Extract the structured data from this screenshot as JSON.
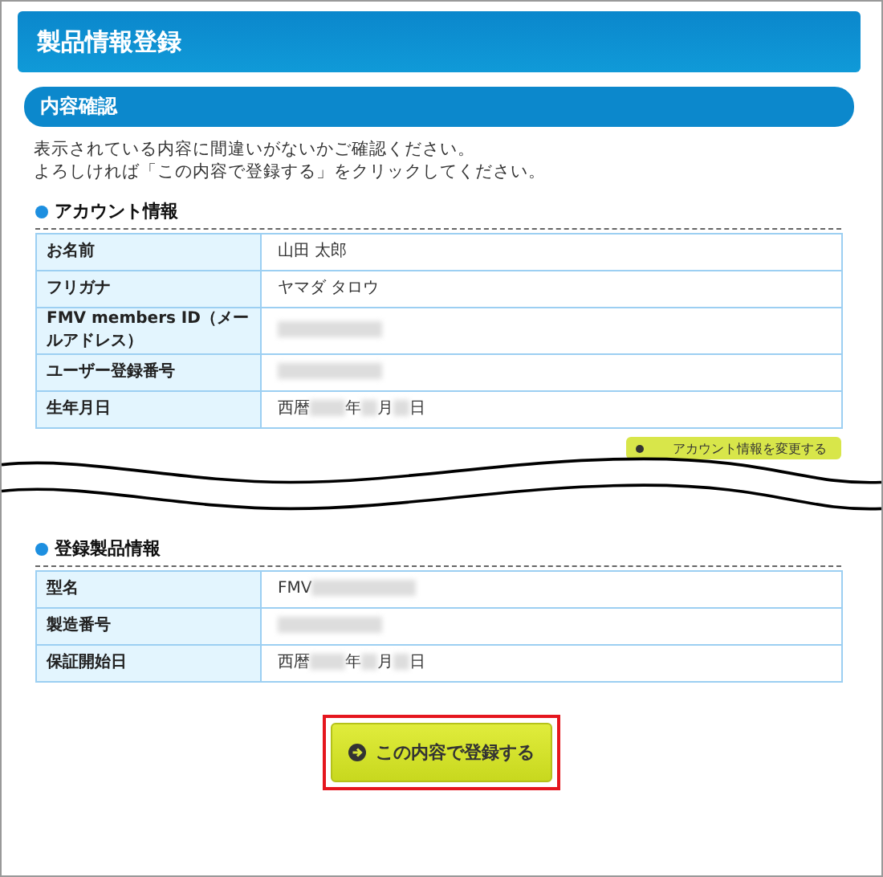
{
  "page_title": "製品情報登録",
  "section_title": "内容確認",
  "intro": [
    "表示されている内容に間違いがないかご確認ください。",
    "よろしければ「この内容で登録する」をクリックしてください。"
  ],
  "account": {
    "heading": "アカウント情報",
    "rows": [
      {
        "label": "お名前",
        "value": [
          {
            "kind": "text",
            "text": "山田 太郎"
          }
        ]
      },
      {
        "label": "フリガナ",
        "value": [
          {
            "kind": "text",
            "text": "ヤマダ タロウ"
          }
        ]
      },
      {
        "label": "FMV members ID（メールアドレス）",
        "value": [
          {
            "kind": "blur"
          }
        ]
      },
      {
        "label": "ユーザー登録番号",
        "value": [
          {
            "kind": "blur"
          }
        ]
      },
      {
        "label": "生年月日",
        "value": [
          {
            "kind": "text",
            "text": "西暦"
          },
          {
            "kind": "blur"
          },
          {
            "kind": "text",
            "text": "年"
          },
          {
            "kind": "blur"
          },
          {
            "kind": "text",
            "text": "月"
          },
          {
            "kind": "blur"
          },
          {
            "kind": "text",
            "text": "日"
          }
        ]
      }
    ],
    "change_button": "アカウント情報を変更する"
  },
  "product": {
    "heading": "登録製品情報",
    "rows": [
      {
        "label": "型名",
        "value": [
          {
            "kind": "text",
            "text": "FMV"
          },
          {
            "kind": "blur"
          }
        ]
      },
      {
        "label": "製造番号",
        "value": [
          {
            "kind": "blur"
          }
        ]
      },
      {
        "label": "保証開始日",
        "value": [
          {
            "kind": "text",
            "text": "西暦"
          },
          {
            "kind": "blur"
          },
          {
            "kind": "text",
            "text": "年"
          },
          {
            "kind": "blur"
          },
          {
            "kind": "text",
            "text": "月"
          },
          {
            "kind": "blur"
          },
          {
            "kind": "text",
            "text": "日"
          }
        ]
      }
    ]
  },
  "submit_button": {
    "label": "この内容で登録する",
    "highlighted": true
  }
}
